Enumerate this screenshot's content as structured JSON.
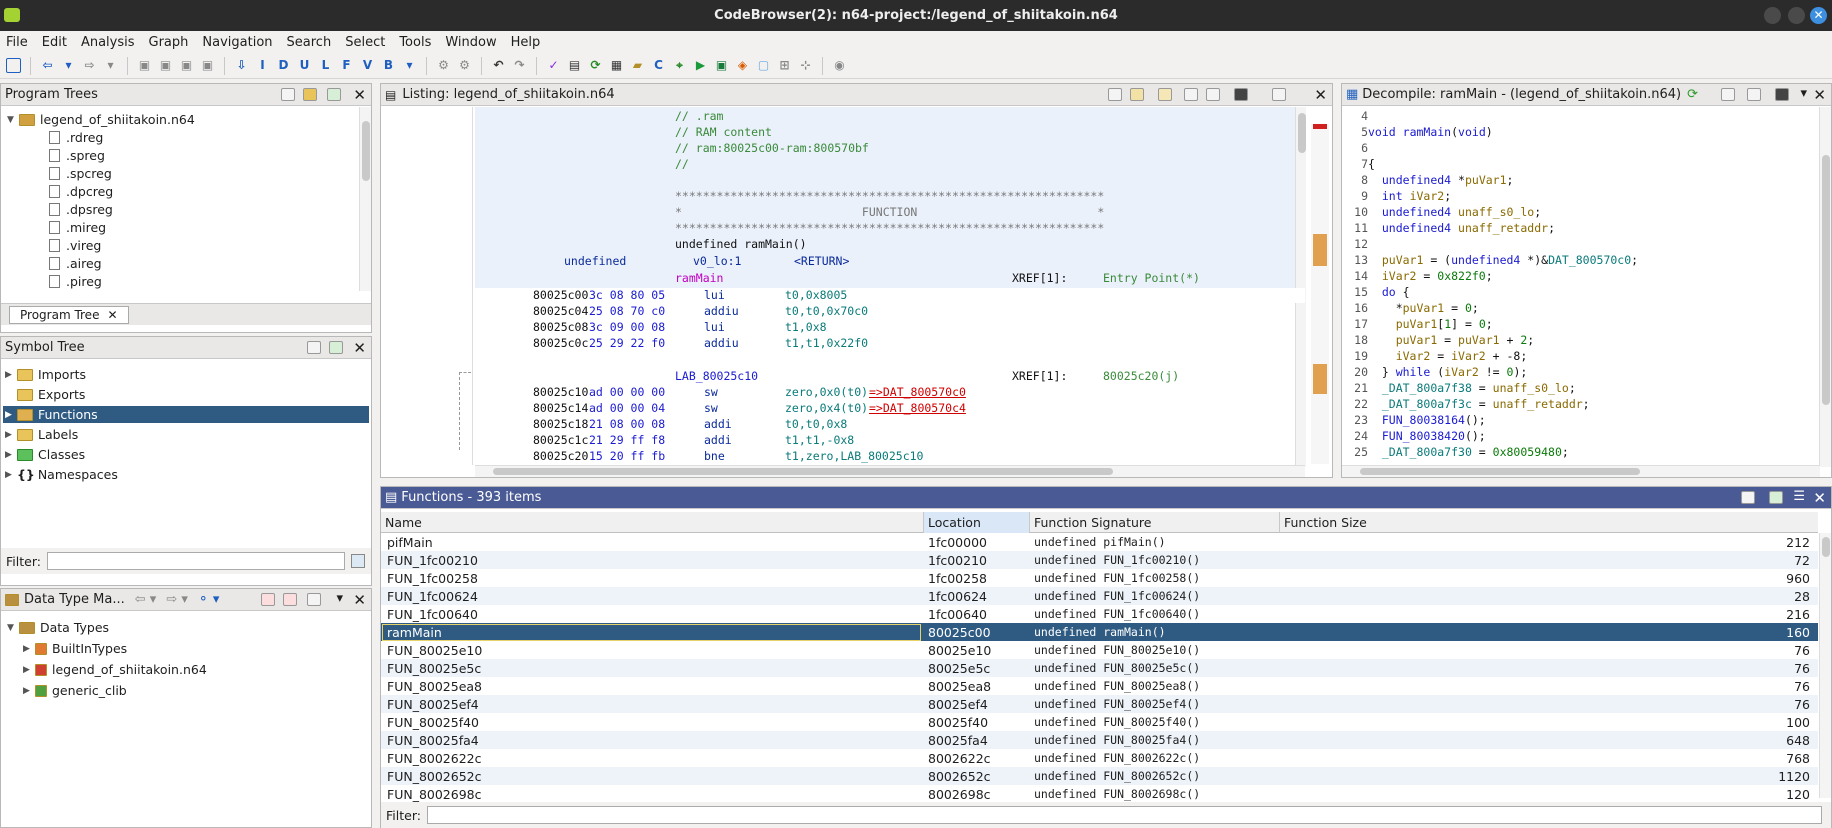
{
  "window": {
    "title": "CodeBrowser(2): n64-project:/legend_of_shiitakoin.n64"
  },
  "menu": [
    "File",
    "Edit",
    "Analysis",
    "Graph",
    "Navigation",
    "Search",
    "Select",
    "Tools",
    "Window",
    "Help"
  ],
  "program_trees": {
    "title": "Program Trees",
    "root": "legend_of_shiitakoin.n64",
    "items": [
      ".rdreg",
      ".spreg",
      ".spcreg",
      ".dpcreg",
      ".dpsreg",
      ".mireg",
      ".vireg",
      ".aireg",
      ".pireg"
    ],
    "tab": "Program Tree"
  },
  "symbol_tree": {
    "title": "Symbol Tree",
    "items": [
      "Imports",
      "Exports",
      "Functions",
      "Labels",
      "Classes",
      "Namespaces"
    ],
    "filter_label": "Filter:"
  },
  "data_types": {
    "title": "Data Type Ma...",
    "root": "Data Types",
    "items": [
      "BuiltInTypes",
      "legend_of_shiitakoin.n64",
      "generic_clib"
    ]
  },
  "listing": {
    "title": "Listing:  legend_of_shiitakoin.n64",
    "comments": [
      "// .ram",
      "// RAM content",
      "// ram:80025c00-ram:800570bf",
      "//"
    ],
    "stars": "**************************************************************",
    "func_banner": "*                          FUNCTION                          *",
    "sig": "undefined ramMain()",
    "ret_type": "undefined",
    "ret_reg": "v0_lo:1",
    "ret_tag": "<RETURN>",
    "label": "ramMain",
    "xref_label": "XREF[1]:",
    "xref_entry": "Entry Point(*)",
    "lines": [
      {
        "addr": "80025c00",
        "bytes": "3c 08 80 05",
        "mn": "lui",
        "ops": "t0,0x8005"
      },
      {
        "addr": "80025c04",
        "bytes": "25 08 70 c0",
        "mn": "addiu",
        "ops": "t0,t0,0x70c0"
      },
      {
        "addr": "80025c08",
        "bytes": "3c 09 00 08",
        "mn": "lui",
        "ops": "t1,0x8"
      },
      {
        "addr": "80025c0c",
        "bytes": "25 29 22 f0",
        "mn": "addiu",
        "ops": "t1,t1,0x22f0"
      }
    ],
    "lab": "LAB_80025c10",
    "lab_xref": "80025c20(j)",
    "lines2": [
      {
        "addr": "80025c10",
        "bytes": "ad 00 00 00",
        "mn": "sw",
        "ops": "zero,0x0(t0)",
        "ref": "=>DAT_800570c0"
      },
      {
        "addr": "80025c14",
        "bytes": "ad 00 00 04",
        "mn": "sw",
        "ops": "zero,0x4(t0)",
        "ref": "=>DAT_800570c4"
      },
      {
        "addr": "80025c18",
        "bytes": "21 08 00 08",
        "mn": "addi",
        "ops": "t0,t0,0x8",
        "ref": ""
      },
      {
        "addr": "80025c1c",
        "bytes": "21 29 ff f8",
        "mn": "addi",
        "ops": "t1,t1,-0x8",
        "ref": ""
      },
      {
        "addr": "80025c20",
        "bytes": "15 20 ff fb",
        "mn": "bne",
        "ops": "t1,zero,LAB_80025c10",
        "ref": ""
      }
    ]
  },
  "decompile": {
    "title": "Decompile: ramMain -  (legend_of_shiitakoin.n64)",
    "lines": [
      {
        "n": "4",
        "t": ""
      },
      {
        "n": "5",
        "t": "void ramMain(void)"
      },
      {
        "n": "6",
        "t": ""
      },
      {
        "n": "7",
        "t": "{"
      },
      {
        "n": "8",
        "t": "  undefined4 *puVar1;"
      },
      {
        "n": "9",
        "t": "  int iVar2;"
      },
      {
        "n": "10",
        "t": "  undefined4 unaff_s0_lo;"
      },
      {
        "n": "11",
        "t": "  undefined4 unaff_retaddr;"
      },
      {
        "n": "12",
        "t": ""
      },
      {
        "n": "13",
        "t": "  puVar1 = (undefined4 *)&DAT_800570c0;"
      },
      {
        "n": "14",
        "t": "  iVar2 = 0x822f0;"
      },
      {
        "n": "15",
        "t": "  do {"
      },
      {
        "n": "16",
        "t": "    *puVar1 = 0;"
      },
      {
        "n": "17",
        "t": "    puVar1[1] = 0;"
      },
      {
        "n": "18",
        "t": "    puVar1 = puVar1 + 2;"
      },
      {
        "n": "19",
        "t": "    iVar2 = iVar2 + -8;"
      },
      {
        "n": "20",
        "t": "  } while (iVar2 != 0);"
      },
      {
        "n": "21",
        "t": "  _DAT_800a7f38 = unaff_s0_lo;"
      },
      {
        "n": "22",
        "t": "  _DAT_800a7f3c = unaff_retaddr;"
      },
      {
        "n": "23",
        "t": "  FUN_80038164();"
      },
      {
        "n": "24",
        "t": "  FUN_80038420();"
      },
      {
        "n": "25",
        "t": "  _DAT_800a7f30 = 0x80059480;"
      }
    ]
  },
  "functions": {
    "title": "Functions - 393 items",
    "columns": [
      "Name",
      "Location",
      "Function Signature",
      "Function Size"
    ],
    "rows": [
      {
        "name": "pifMain",
        "loc": "1fc00000",
        "sig": "undefined pifMain()",
        "size": "212"
      },
      {
        "name": "FUN_1fc00210",
        "loc": "1fc00210",
        "sig": "undefined FUN_1fc00210()",
        "size": "72"
      },
      {
        "name": "FUN_1fc00258",
        "loc": "1fc00258",
        "sig": "undefined FUN_1fc00258()",
        "size": "960"
      },
      {
        "name": "FUN_1fc00624",
        "loc": "1fc00624",
        "sig": "undefined FUN_1fc00624()",
        "size": "28"
      },
      {
        "name": "FUN_1fc00640",
        "loc": "1fc00640",
        "sig": "undefined FUN_1fc00640()",
        "size": "216"
      },
      {
        "name": "ramMain",
        "loc": "80025c00",
        "sig": "undefined ramMain()",
        "size": "160"
      },
      {
        "name": "FUN_80025e10",
        "loc": "80025e10",
        "sig": "undefined FUN_80025e10()",
        "size": "76"
      },
      {
        "name": "FUN_80025e5c",
        "loc": "80025e5c",
        "sig": "undefined FUN_80025e5c()",
        "size": "76"
      },
      {
        "name": "FUN_80025ea8",
        "loc": "80025ea8",
        "sig": "undefined FUN_80025ea8()",
        "size": "76"
      },
      {
        "name": "FUN_80025ef4",
        "loc": "80025ef4",
        "sig": "undefined FUN_80025ef4()",
        "size": "76"
      },
      {
        "name": "FUN_80025f40",
        "loc": "80025f40",
        "sig": "undefined FUN_80025f40()",
        "size": "100"
      },
      {
        "name": "FUN_80025fa4",
        "loc": "80025fa4",
        "sig": "undefined FUN_80025fa4()",
        "size": "648"
      },
      {
        "name": "FUN_8002622c",
        "loc": "8002622c",
        "sig": "undefined FUN_8002622c()",
        "size": "768"
      },
      {
        "name": "FUN_8002652c",
        "loc": "8002652c",
        "sig": "undefined FUN_8002652c()",
        "size": "1120"
      },
      {
        "name": "FUN_8002698c",
        "loc": "8002698c",
        "sig": "undefined FUN_8002698c()",
        "size": "120"
      }
    ],
    "filter_label": "Filter:"
  }
}
